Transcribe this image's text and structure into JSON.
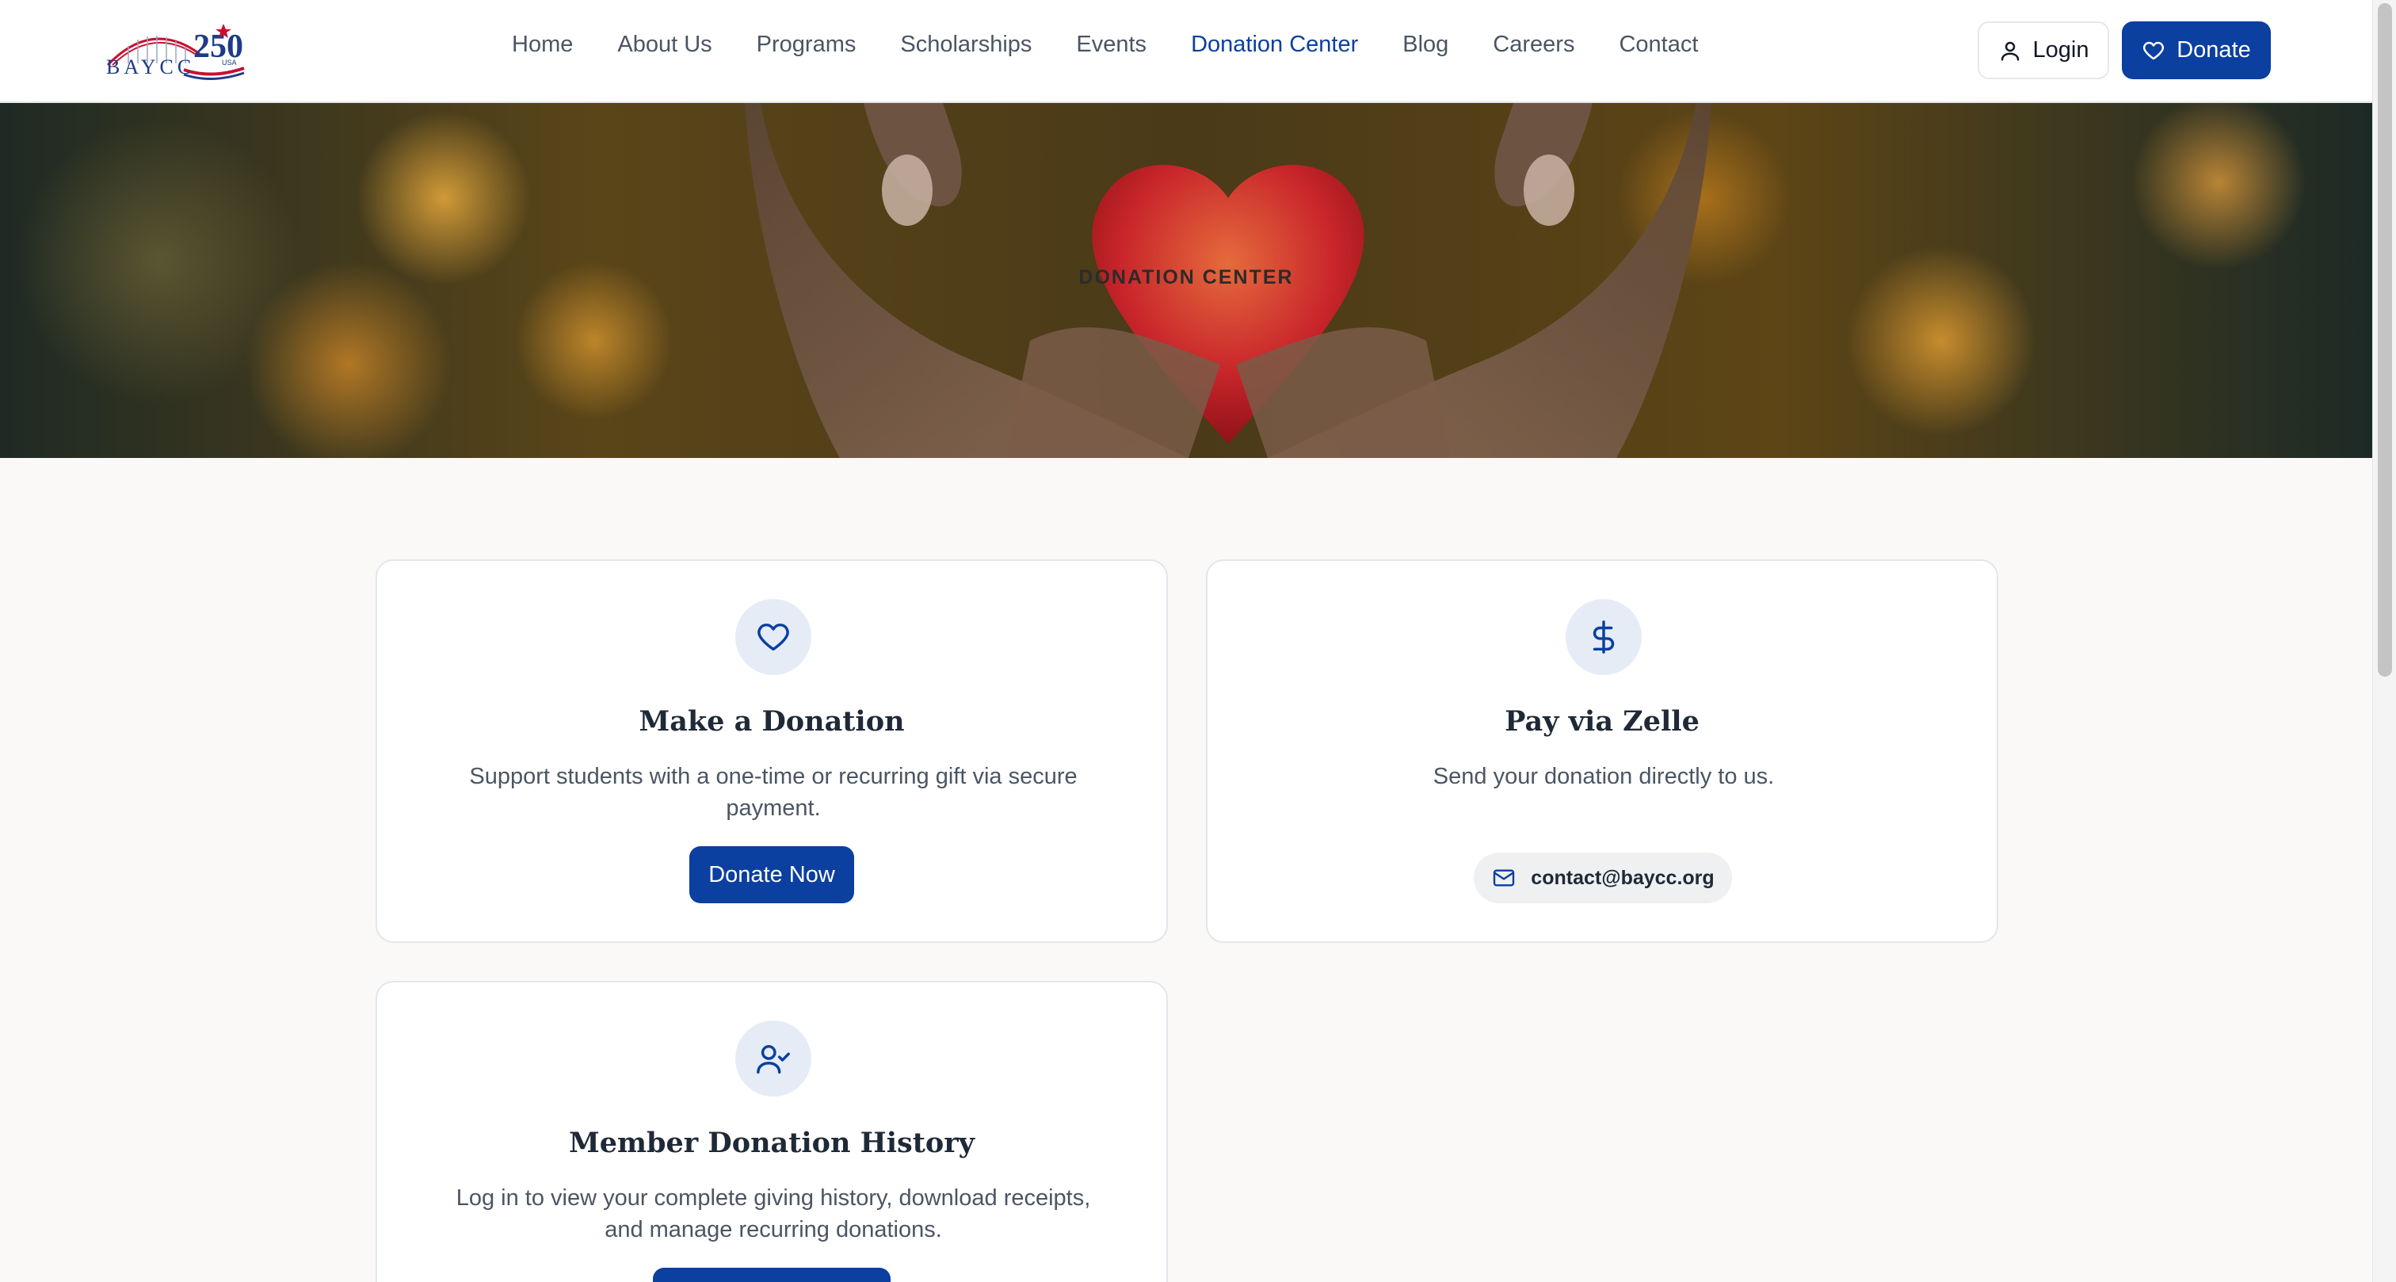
{
  "header": {
    "logo_text": "BAYCC",
    "logo_number": "250",
    "logo_badge": "USA",
    "nav": [
      {
        "label": "Home"
      },
      {
        "label": "About Us"
      },
      {
        "label": "Programs"
      },
      {
        "label": "Scholarships"
      },
      {
        "label": "Events"
      },
      {
        "label": "Donation Center",
        "active": true
      },
      {
        "label": "Blog"
      },
      {
        "label": "Careers"
      },
      {
        "label": "Contact"
      }
    ],
    "login_label": "Login",
    "donate_label": "Donate"
  },
  "hero": {
    "title": "DONATION CENTER"
  },
  "cards": {
    "donation": {
      "icon": "heart-icon",
      "title": "Make a Donation",
      "description": "Support students with a one-time or recurring gift via secure payment.",
      "button": "Donate Now"
    },
    "zelle": {
      "icon": "dollar-icon",
      "title": "Pay via Zelle",
      "description": "Send your donation directly to us.",
      "email": "contact@baycc.org"
    },
    "history": {
      "icon": "user-check-icon",
      "title": "Member Donation History",
      "description": "Log in to view your complete giving history, download receipts, and manage recurring donations."
    }
  },
  "colors": {
    "primary": "#0b3fa0",
    "icon_bg": "#e6ecf6",
    "page_bg": "#faf9f7",
    "logo_red": "#c8102e"
  }
}
